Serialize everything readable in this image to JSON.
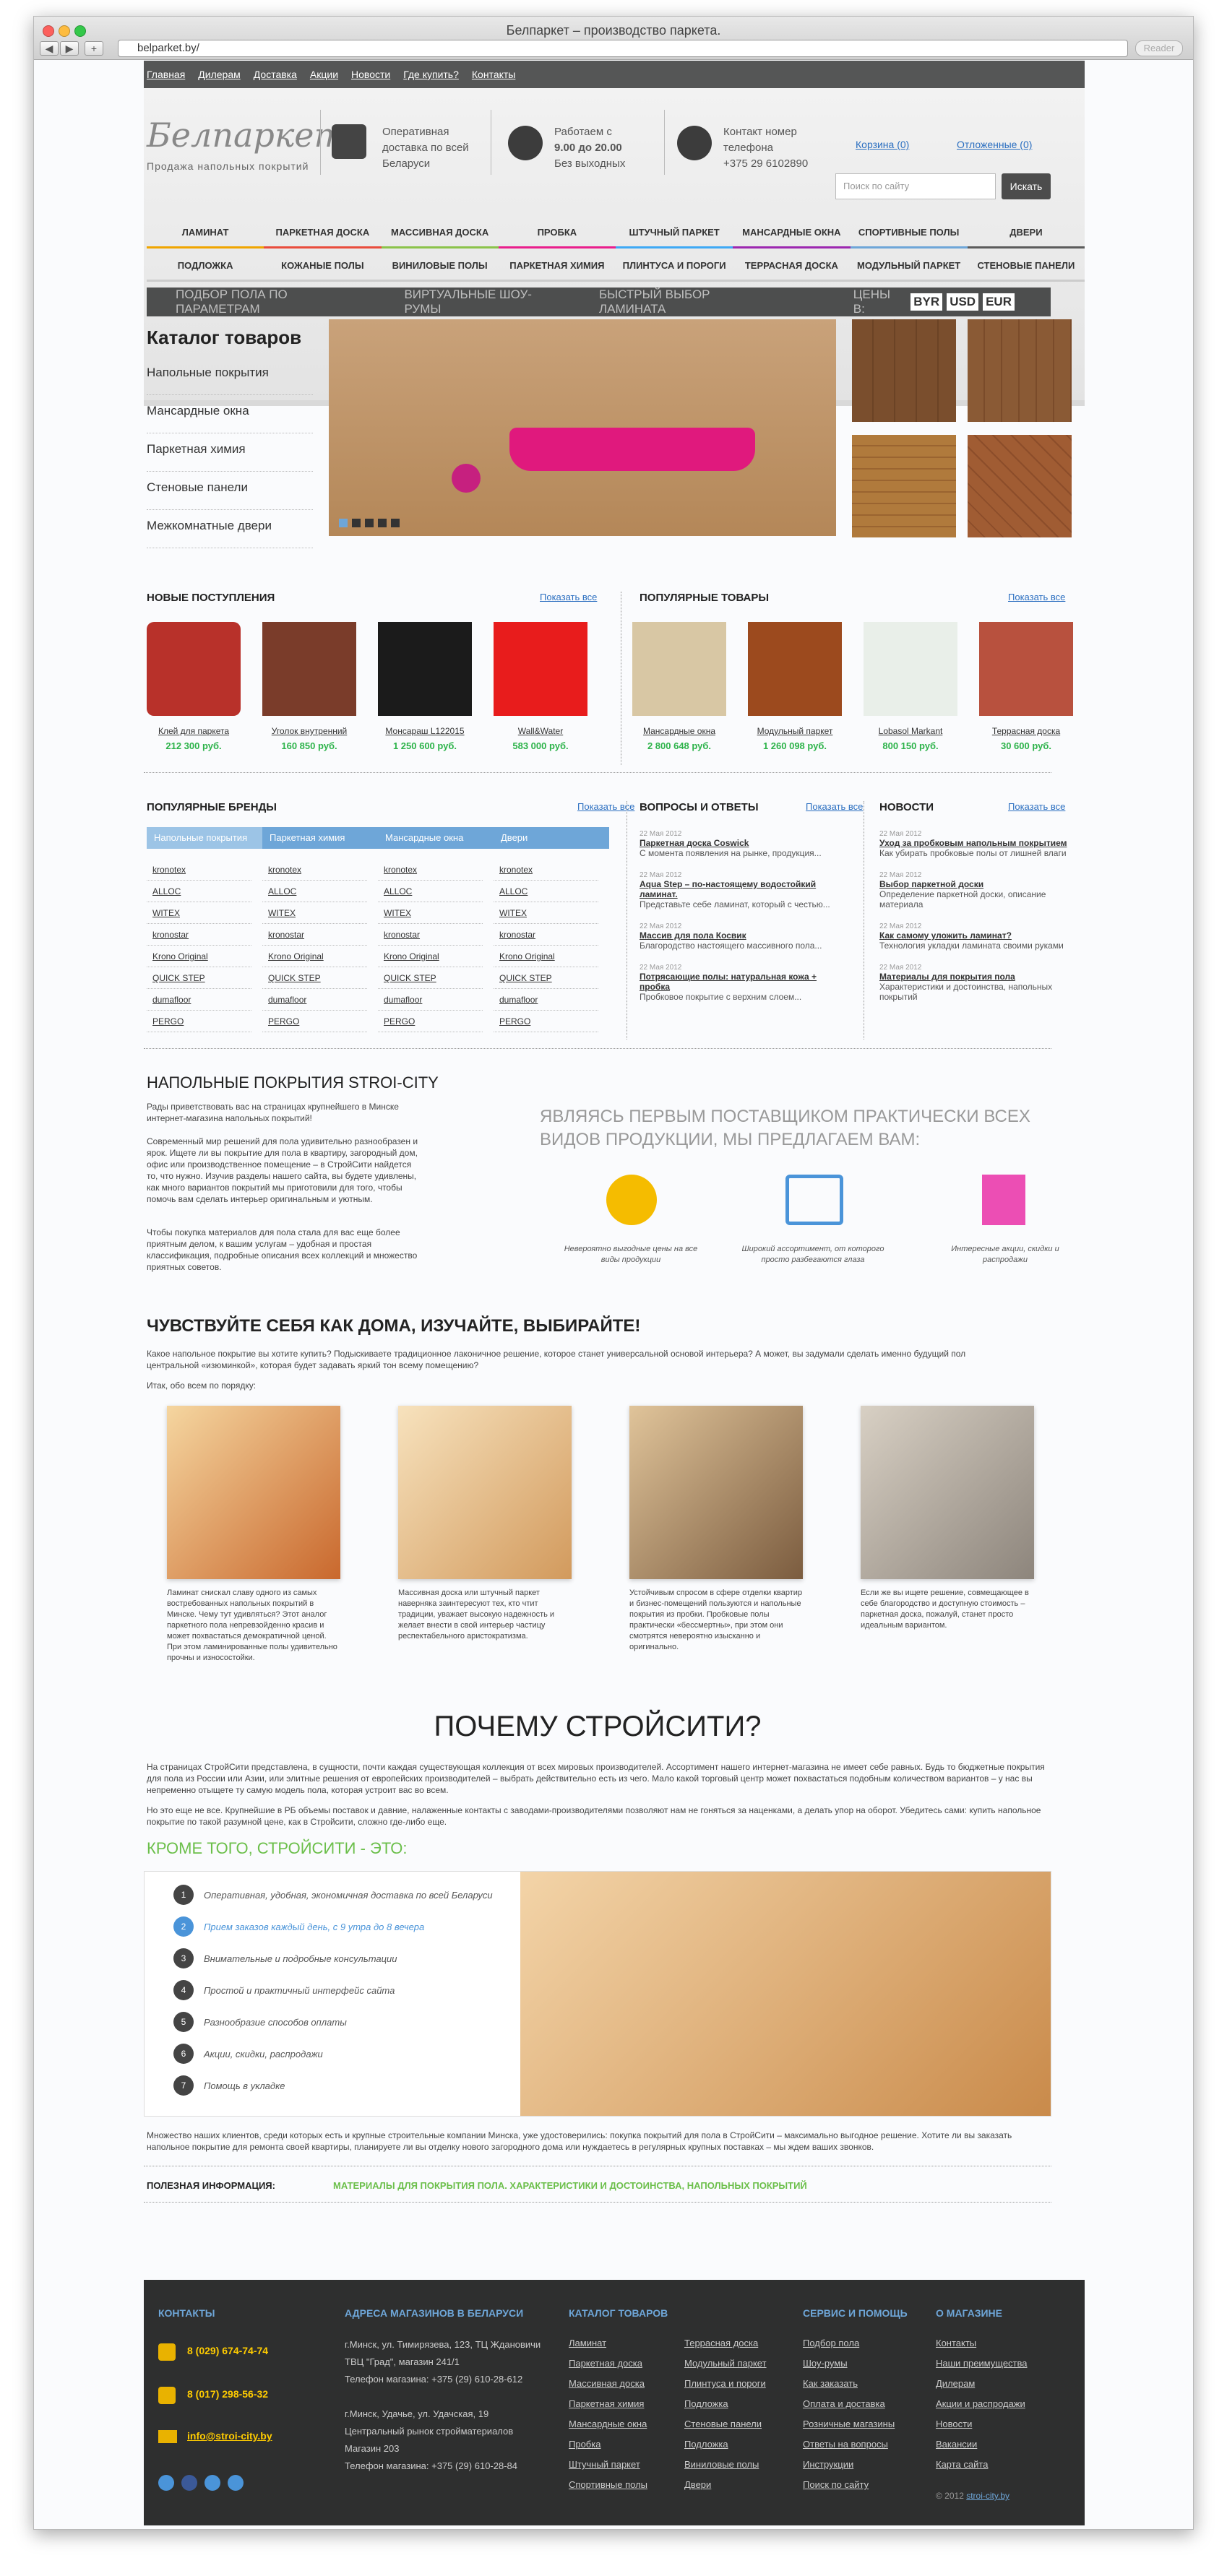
{
  "window": {
    "title": "Белпаркет – производство паркета.",
    "url": "belparket.by/",
    "reader": "Reader"
  },
  "topnav": [
    "Главная",
    "Дилерам",
    "Доставка",
    "Акции",
    "Новости",
    "Где купить?",
    "Контакты"
  ],
  "logo": {
    "name": "Белпаркет",
    "slogan": "Продажа напольных покрытий"
  },
  "header": {
    "delivery": "Оперативная доставка по всей Беларуси",
    "hours_title": "Работаем с",
    "hours": "9.00 до 20.00",
    "weekends": "Без выходных",
    "phone_label": "Контакт номер телефона",
    "phone": "+375 29 6102890",
    "cart": "Корзина (0)",
    "deferred": "Отложенные (0)",
    "search_placeholder": "Поиск по сайту",
    "search_button": "Искать"
  },
  "cat_row1": [
    "ЛАМИНАТ",
    "ПАРКЕТНАЯ ДОСКА",
    "МАССИВНАЯ ДОСКА",
    "ПРОБКА",
    "ШТУЧНЫЙ ПАРКЕТ",
    "МАНСАРДНЫЕ ОКНА",
    "СПОРТИВНЫЕ ПОЛЫ",
    "ДВЕРИ"
  ],
  "cat_row2": [
    "ПОДЛОЖКА",
    "КОЖАНЫЕ ПОЛЫ",
    "ВИНИЛОВЫЕ ПОЛЫ",
    "ПАРКЕТНАЯ ХИМИЯ",
    "ПЛИНТУСА И ПОРОГИ",
    "ТЕРРАСНАЯ ДОСКА",
    "МОДУЛЬНЫЙ ПАРКЕТ",
    "СТЕНОВЫЕ ПАНЕЛИ"
  ],
  "cat_row_colors": [
    "#f0a500",
    "#e94c3c",
    "#8bc34a",
    "#e91e8c",
    "#3fa9f5",
    "#9c27b0",
    "#6ea6d8",
    "#5b5b5b"
  ],
  "filterbar": {
    "items": [
      "ПОДБОР ПОЛА ПО ПАРАМЕТРАМ",
      "ВИРТУАЛЬНЫЕ ШОУ-РУМЫ",
      "БЫСТРЫЙ ВЫБОР ЛАМИНАТА"
    ],
    "prices": "ЦЕНЫ В:",
    "currencies": [
      "BYR",
      "USD",
      "EUR"
    ]
  },
  "catalog": {
    "title": "Каталог товаров",
    "items": [
      "Напольные покрытия",
      "Мансардные окна",
      "Паркетная химия",
      "Стеновые панели",
      "Межкомнатные двери"
    ]
  },
  "new_arrivals": {
    "title": "НОВЫЕ ПОСТУПЛЕНИЯ",
    "show_all": "Показать все",
    "items": [
      {
        "name": "Клей для паркета",
        "price": "212 300 руб."
      },
      {
        "name": "Уголок внутренний",
        "price": "160 850 руб."
      },
      {
        "name": "Монсараш L122015",
        "price": "1 250 600 руб."
      },
      {
        "name": "Wall&Water",
        "price": "583 000 руб."
      }
    ]
  },
  "popular": {
    "title": "ПОПУЛЯРНЫЕ ТОВАРЫ",
    "show_all": "Показать все",
    "items": [
      {
        "name": "Мансардные окна",
        "price": "2 800 648 руб."
      },
      {
        "name": "Модульный паркет",
        "price": "1 260 098 руб."
      },
      {
        "name": "Lobasol Markant",
        "price": "800 150 руб."
      },
      {
        "name": "Террасная доска",
        "price": "30 600 руб."
      }
    ]
  },
  "brands": {
    "title": "ПОПУЛЯРНЫЕ БРЕНДЫ",
    "show_all": "Показать все",
    "tabs": [
      "Напольные покрытия",
      "Паркетная химия",
      "Мансардные окна",
      "Двери"
    ],
    "list": [
      "kronotex",
      "ALLOC",
      "WITEX",
      "kronostar",
      "Krono Original",
      "QUICK STEP",
      "dumafloor",
      "PERGO"
    ]
  },
  "qa": {
    "title": "ВОПРОСЫ И ОТВЕТЫ",
    "show_all": "Показать все",
    "items": [
      {
        "date": "22 Мая 2012",
        "title": "Паркетная доска Coswick",
        "text": "С момента появления на рынке, продукция..."
      },
      {
        "date": "22 Мая 2012",
        "title": "Aqua Step – по-настоящему водостойкий ламинат.",
        "text": "Представьте себе ламинат, который с честью..."
      },
      {
        "date": "22 Мая 2012",
        "title": "Массив для пола Косвик",
        "text": "Благородство настоящего массивного пола..."
      },
      {
        "date": "22 Мая 2012",
        "title": "Потрясающие полы: натуральная кожа + пробка",
        "text": "Пробковое покрытие с верхним слоем..."
      }
    ]
  },
  "news": {
    "title": "НОВОСТИ",
    "show_all": "Показать все",
    "items": [
      {
        "date": "22 Мая 2012",
        "title": "Уход за пробковым напольным покрытием",
        "text": "Как убирать пробковые полы от лишней влаги"
      },
      {
        "date": "22 Мая 2012",
        "title": "Выбор паркетной доски",
        "text": "Определение паркетной доски, описание материала"
      },
      {
        "date": "22 Мая 2012",
        "title": "Как самому уложить ламинат?",
        "text": "Технология укладки ламината своими руками"
      },
      {
        "date": "22 Мая 2012",
        "title": "Материалы для покрытия пола",
        "text": "Характеристики и достоинства, напольных покрытий"
      }
    ]
  },
  "about": {
    "title": "НАПОЛЬНЫЕ ПОКРЫТИЯ STROI-CITY",
    "p1": "Рады приветствовать вас на страницах крупнейшего в Минске интернет-магазина напольных покрытий!",
    "p2": "Современный мир решений для пола удивительно разнообразен и ярок. Ищете ли вы покрытие для пола в квартиру, загородный дом, офис или производственное помещение – в СтройСити найдется то, что нужно. Изучив разделы нашего сайта, вы будете удивлены, как много вариантов покрытий мы приготовили для того, чтобы помочь вам сделать интерьер оригинальным и уютным.",
    "p3": "Чтобы покупка материалов для пола стала для вас еще более приятным делом, к вашим услугам – удобная и простая классификация, подробные описания всех коллекций и множество приятных советов.",
    "lead": "ЯВЛЯЯСЬ ПЕРВЫМ ПОСТАВЩИКОМ ПРАКТИЧЕСКИ ВСЕХ ВИДОВ ПРОДУКЦИИ, МЫ ПРЕДЛАГАЕМ ВАМ:",
    "features": [
      "Невероятно выгодные цены на все виды продукции",
      "Широкий ассортимент, от которого просто разбегаются глаза",
      "Интересные акции, скидки и распродажи"
    ]
  },
  "home": {
    "title": "ЧУВСТВУЙТЕ СЕБЯ КАК ДОМА, ИЗУЧАЙТЕ, ВЫБИРАЙТЕ!",
    "intro": "Какое напольное покрытие вы хотите купить? Подыскиваете традиционное лаконичное решение, которое станет универсальной основой интерьера? А может, вы задумали сделать именно будущий пол центральной «изюминкой», которая будет задавать яркий тон всему помещению?",
    "sub": "Итак, обо всем по порядку:",
    "items": [
      "Ламинат снискал славу одного из самых востребованных напольных покрытий в Минске. Чему тут удивляться? Этот аналог паркетного пола непревзойденно красив и может похвастаться демократичной ценой. При этом ламинированные полы удивительно прочны и износостойки.",
      "Массивная доска или штучный паркет наверняка заинтересуют тех, кто чтит традиции, уважает высокую надежность и желает внести в свой интерьер частицу респектабельного аристократизма.",
      "Устойчивым спросом в сфере отделки квартир и бизнес-помещений пользуются и напольные покрытия из пробки. Пробковые полы практически «бессмертны», при этом они смотрятся невероятно изысканно и оригинально.",
      "Если же вы ищете решение, совмещающее в себе благородство и доступную стоимость – паркетная доска, пожалуй, станет просто идеальным вариантом."
    ]
  },
  "why": {
    "title": "ПОЧЕМУ СТРОЙСИТИ?",
    "p1": "На страницах СтройСити представлена, в сущности, почти каждая существующая коллекция от всех мировых производителей. Ассортимент нашего интернет-магазина не имеет себе равных. Будь то бюджетные покрытия для пола из России или Азии, или элитные решения от европейских производителей – выбрать действительно есть из чего. Мало какой торговый центр может похвастаться подобным количеством вариантов – у нас вы непременно отыщете ту самую модель пола, которая устроит вас во всем.",
    "p2": "Но это еще не все. Крупнейшие в РБ объемы поставок и давние, налаженные контакты с заводами-производителями позволяют нам не гоняться за наценками, а делать упор на оборот. Убедитесь сами: купить напольное покрытие по такой разумной цене, как в Стройсити, сложно где-либо еще.",
    "more": "КРОМЕ ТОГО, СТРОЙСИТИ - ЭТО:",
    "steps": [
      "Оперативная, удобная, экономичная доставка по всей Беларуси",
      "Прием заказов каждый день, с 9 утра до 8 вечера",
      "Внимательные и подробные консультации",
      "Простой и практичный интерфейс сайта",
      "Разнообразие способов оплаты",
      "Акции, скидки, распродажи",
      "Помощь в укладке"
    ],
    "p3": "Множество наших клиентов, среди которых есть и крупные строительные компании Минска, уже удостоверились: покупка покрытий для пола в СтройСити – максимально выгодное решение. Хотите ли вы заказать напольное покрытие для ремонта своей квартиры, планируете ли вы отделку нового загородного дома или нуждаетесь в регулярных крупных поставках – мы ждем ваших звонков."
  },
  "useful": {
    "label": "ПОЛЕЗНАЯ ИНФОРМАЦИЯ:",
    "link": "МАТЕРИАЛЫ ДЛЯ ПОКРЫТИЯ ПОЛА. ХАРАКТЕРИСТИКИ И ДОСТОИНСТВА, НАПОЛЬНЫХ ПОКРЫТИЙ"
  },
  "footer": {
    "contacts_title": "КОНТАКТЫ",
    "phone1": "8 (029) 674-74-74",
    "phone2": "8 (017) 298-56-32",
    "email": "info@stroi-city.by",
    "addr_title": "АДРЕСА МАГАЗИНОВ В БЕЛАРУСИ",
    "addr1": "г.Минск, ул. Тимирязева, 123, ТЦ Ждановичи",
    "addr2": "ТВЦ \"Град\", магазин 241/1",
    "addr3": "Телефон магазина: +375 (29) 610-28-612",
    "addr4": "г.Минск, Удачье, ул. Удачская, 19",
    "addr5": "Центральный рынок стройматериалов",
    "addr6": "Магазин 203",
    "addr7": "Телефон магазина: +375 (29) 610-28-84",
    "catalog_title": "КАТАЛОГ ТОВАРОВ",
    "catalog1": [
      "Ламинат",
      "Паркетная доска",
      "Массивная доска",
      "Паркетная химия",
      "Мансардные окна",
      "Пробка",
      "Штучный паркет",
      "Спортивные полы"
    ],
    "catalog2": [
      "Террасная доска",
      "Модульный паркет",
      "Плинтуса и пороги",
      "Подложка",
      "Стеновые панели",
      "Подложка",
      "Виниловые полы",
      "Двери"
    ],
    "service_title": "СЕРВИС И ПОМОЩЬ",
    "service": [
      "Подбор пола",
      "Шоу-румы",
      "Как заказать",
      "Оплата и доставка",
      "Розничные магазины",
      "Ответы на вопросы",
      "Инструкции",
      "Поиск по сайту"
    ],
    "company_title": "О МАГАЗИНЕ",
    "company": [
      "Контакты",
      "Наши преимущества",
      "Дилерам",
      "Акции и распродажи",
      "Новости",
      "Вакансии",
      "Карта сайта"
    ],
    "copyright": "© 2012",
    "copy_link": "stroi-city.by"
  }
}
